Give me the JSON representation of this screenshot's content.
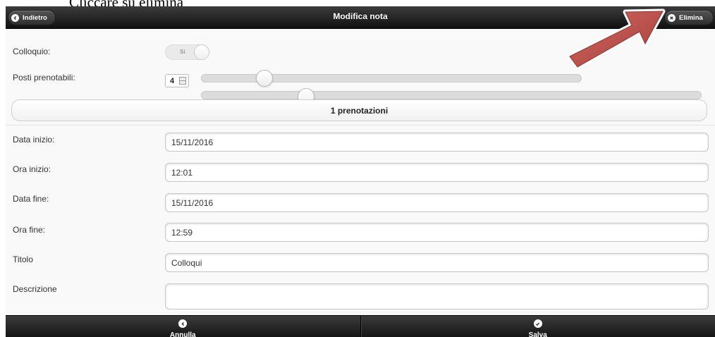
{
  "caption": "Cliccare su elimina",
  "header": {
    "title": "Modifica nota",
    "back_label": "Indietro",
    "delete_label": "Elimina"
  },
  "form": {
    "colloquio": {
      "label": "Colloquio:",
      "toggle_text": "Si"
    },
    "posti": {
      "label": "Posti prenotabili:",
      "value": "4"
    },
    "prenotazioni_button": "1 prenotazioni",
    "data_inizio": {
      "label": "Data inizio:",
      "value": "15/11/2016"
    },
    "ora_inizio": {
      "label": "Ora inizio:",
      "value": "12:01"
    },
    "data_fine": {
      "label": "Data fine:",
      "value": "15/11/2016"
    },
    "ora_fine": {
      "label": "Ora fine:",
      "value": "12:59"
    },
    "titolo": {
      "label": "Titolo",
      "value": "Colloqui"
    },
    "descrizione": {
      "label": "Descrizione",
      "value": ""
    }
  },
  "footer": {
    "cancel_label": "Annulla",
    "save_label": "Salva"
  },
  "icons": {
    "back": "chevron-left-icon",
    "delete": "close-icon",
    "cancel": "chevron-left-icon",
    "save": "check-icon",
    "annotation": "red-arrow-icon"
  },
  "colors": {
    "header_bg": "#222222",
    "annotation_arrow": "#c0504d"
  }
}
